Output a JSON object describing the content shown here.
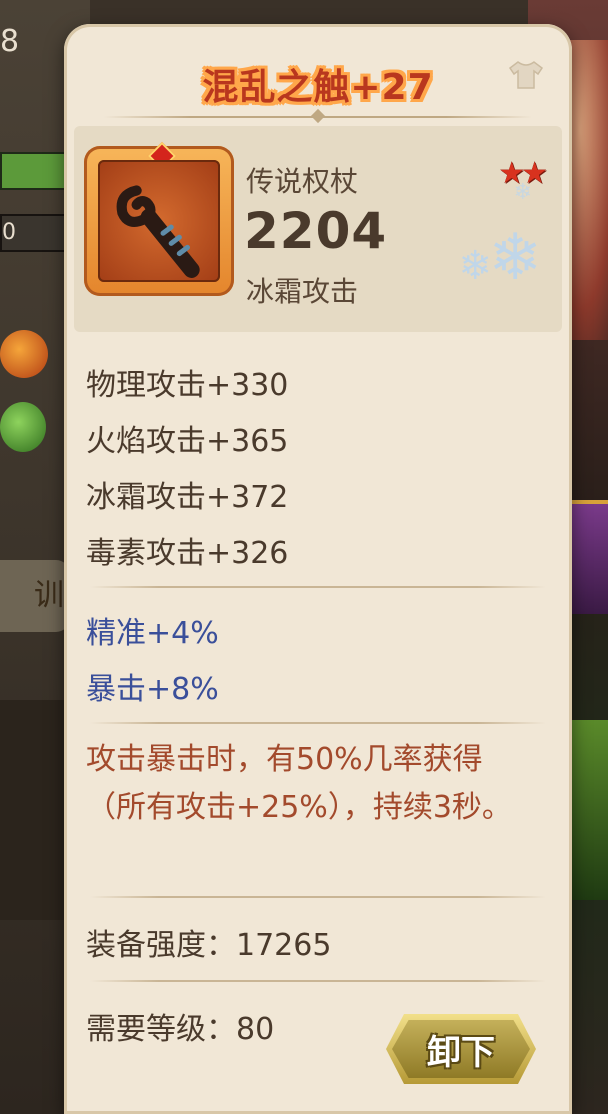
{
  "background": {
    "left_number": "8",
    "left_bar_text": "0",
    "left_button_char": "训"
  },
  "item": {
    "title": "混乱之触+27",
    "type": "传说权杖",
    "power": "2204",
    "element": "冰霜攻击",
    "stars": "★★",
    "star_count": 2,
    "frame_color": "#e4852c"
  },
  "stats": {
    "base": [
      "物理攻击+330",
      "火焰攻击+365",
      "冰霜攻击+372",
      "毒素攻击+326"
    ],
    "bonus": [
      "精准+4%",
      "暴击+8%"
    ]
  },
  "skill_text": "攻击暴击时，有50%几率获得（所有攻击+25%），持续3秒。",
  "info": {
    "strength_label": "装备强度：",
    "strength_value": "17265",
    "level_label": "需要等级：",
    "level_value": "80"
  },
  "actions": {
    "unequip_label": "卸下"
  },
  "icons": {
    "equip_slot": "shirt-icon",
    "element": "snowflake-icon",
    "rarity": "star-icon"
  },
  "colors": {
    "title_outline": "#ffa74a",
    "skill_text": "#a34a2c",
    "bonus_text": "#3a4f9a",
    "panel": "#f1e7d6"
  }
}
